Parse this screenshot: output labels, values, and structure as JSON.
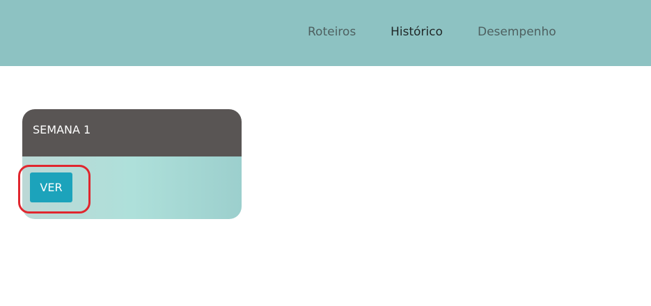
{
  "nav": {
    "items": [
      {
        "label": "Roteiros",
        "active": false
      },
      {
        "label": "Histórico",
        "active": true
      },
      {
        "label": "Desempenho",
        "active": false
      }
    ]
  },
  "card": {
    "title": "SEMANA 1",
    "button_label": "VER"
  },
  "colors": {
    "navbar": "#8dc2c2",
    "card_header": "#595554",
    "button": "#1ca3bb",
    "highlight": "#e0262e"
  }
}
